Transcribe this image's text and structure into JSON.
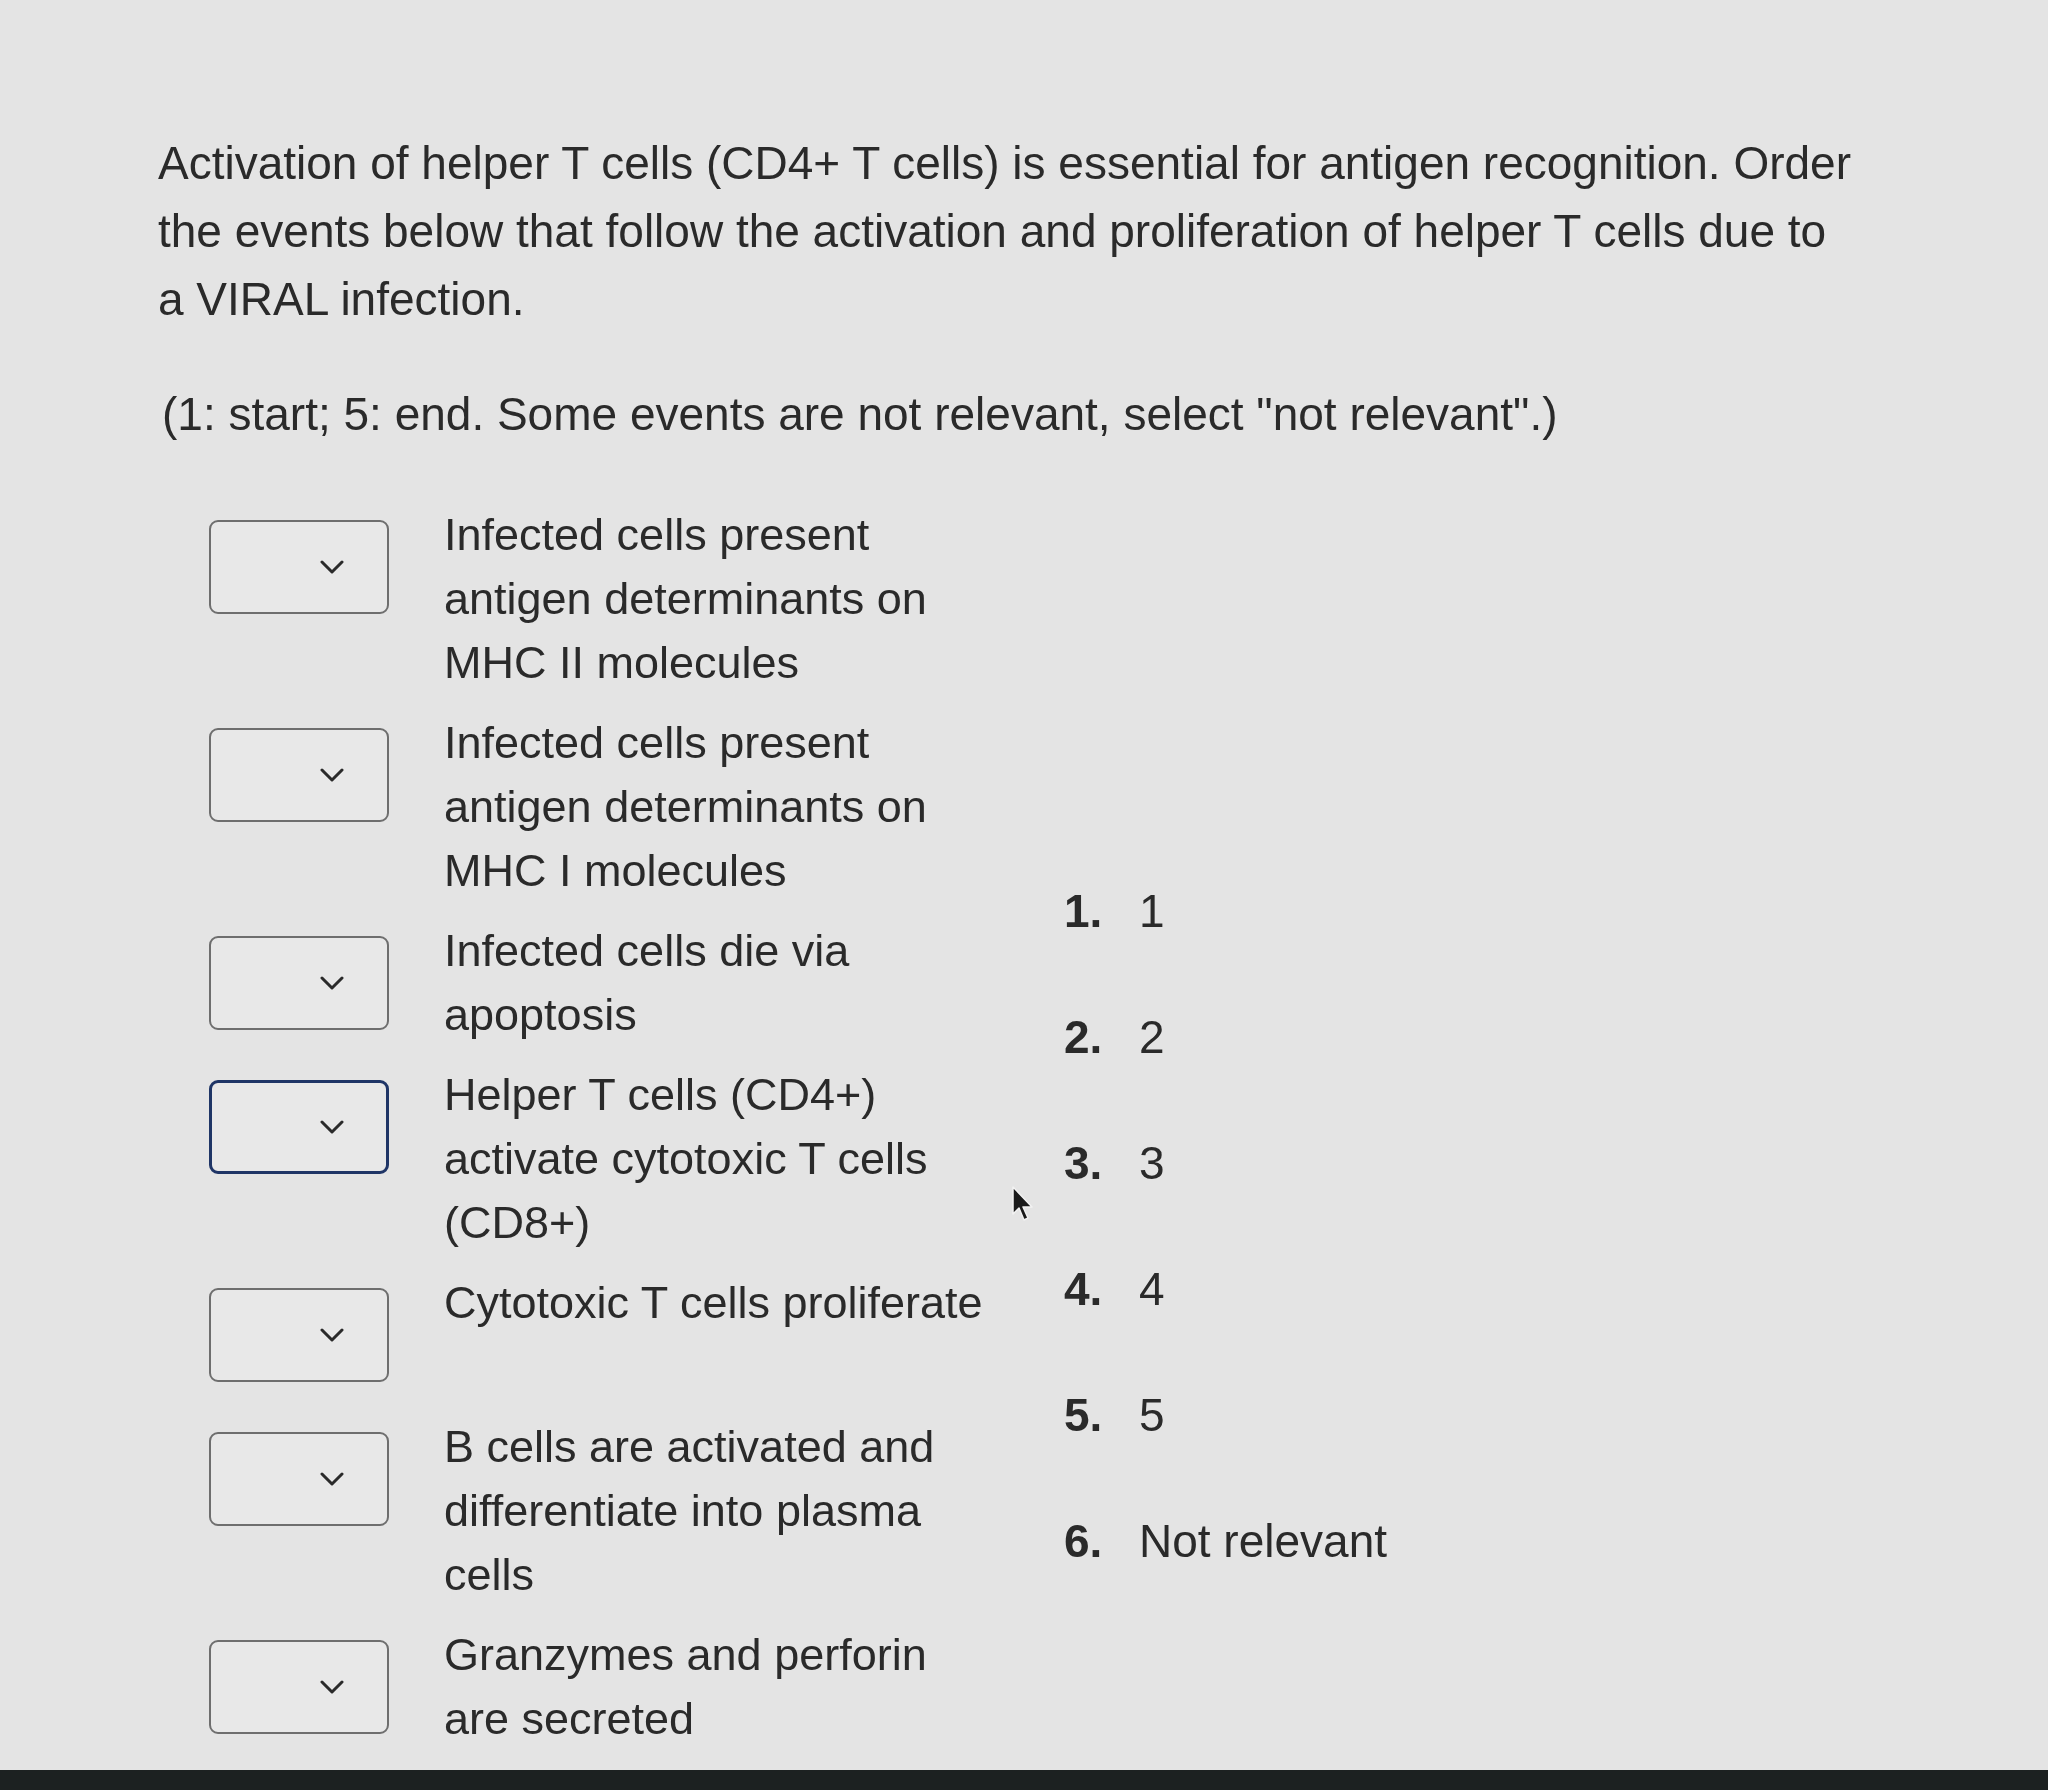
{
  "question": {
    "prompt": "Activation of helper T cells (CD4+ T cells) is essential for antigen recognition. Order the events below that follow the activation and proliferation of helper T cells due to a VIRAL infection.",
    "instructions": "(1: start; 5: end. Some events are not relevant, select \"not relevant\".)"
  },
  "events": [
    {
      "text": "Infected cells present antigen determinants on MHC II molecules",
      "focused": false
    },
    {
      "text": "Infected cells present antigen determinants on MHC I molecules",
      "focused": false
    },
    {
      "text": "Infected cells die via apoptosis",
      "focused": false
    },
    {
      "text": "Helper T cells (CD4+) activate cytotoxic T cells (CD8+)",
      "focused": true
    },
    {
      "text": "Cytotoxic T cells proliferate",
      "focused": false
    },
    {
      "text": "B cells are activated and differentiate into plasma cells",
      "focused": false
    },
    {
      "text": "Granzymes and perforin are secreted",
      "focused": false
    }
  ],
  "options": [
    {
      "number": "1.",
      "label": "1"
    },
    {
      "number": "2.",
      "label": "2"
    },
    {
      "number": "3.",
      "label": "3"
    },
    {
      "number": "4.",
      "label": "4"
    },
    {
      "number": "5.",
      "label": "5"
    },
    {
      "number": "6.",
      "label": "Not relevant"
    }
  ]
}
